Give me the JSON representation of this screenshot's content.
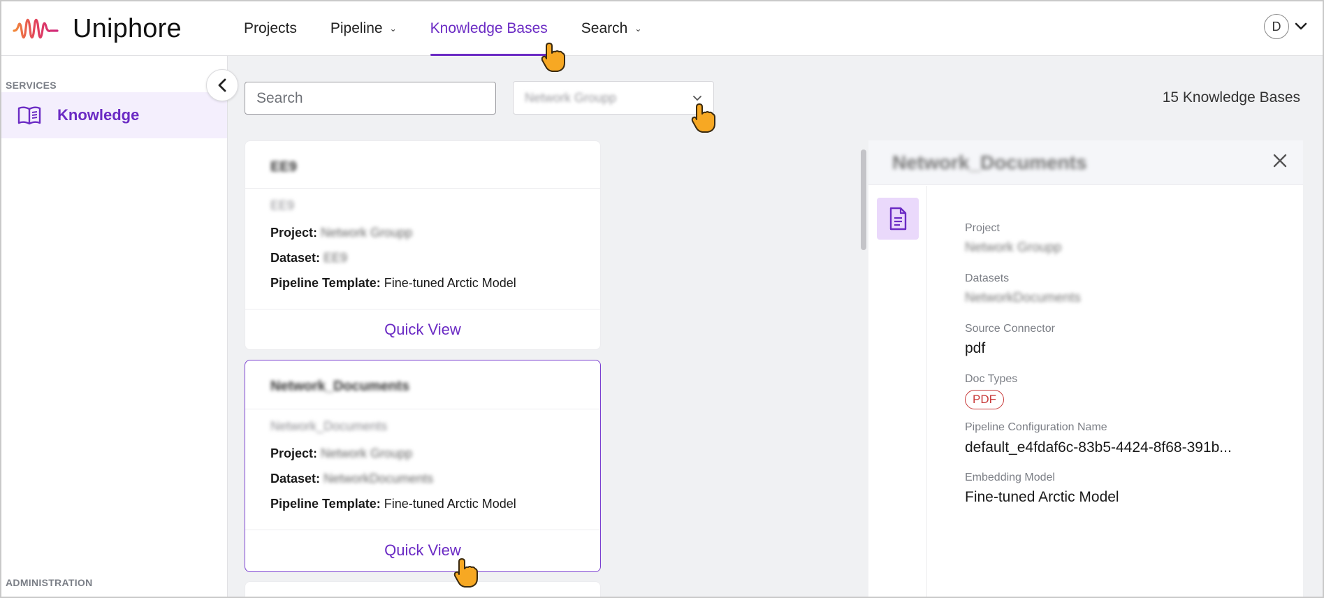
{
  "app": {
    "brand": "Uniphore",
    "accent": "#6b2bc4"
  },
  "nav": {
    "items": [
      {
        "label": "Projects",
        "has_menu": false
      },
      {
        "label": "Pipeline",
        "has_menu": true
      },
      {
        "label": "Knowledge Bases",
        "has_menu": false,
        "active": true
      },
      {
        "label": "Search",
        "has_menu": true
      }
    ],
    "user_initial": "D"
  },
  "sidebar": {
    "services_label": "SERVICES",
    "items": [
      {
        "label": "Knowledge",
        "icon": "book-icon",
        "active": true
      }
    ],
    "administration_label": "ADMINISTRATION"
  },
  "toolbar": {
    "search_placeholder": "Search",
    "project_filter_value": "Network Groupp",
    "count_text": "15 Knowledge Bases"
  },
  "cards": [
    {
      "title": "EE9",
      "subtitle": "EE9",
      "project_label": "Project:",
      "project_value": "Network Groupp",
      "dataset_label": "Dataset:",
      "dataset_value": "EE9",
      "template_label": "Pipeline Template:",
      "template_value": "Fine-tuned Arctic Model",
      "action": "Quick View"
    },
    {
      "title": "Network_Documents",
      "subtitle": "Network_Documents",
      "project_label": "Project:",
      "project_value": "Network Groupp",
      "dataset_label": "Dataset:",
      "dataset_value": "NetworkDocuments",
      "template_label": "Pipeline Template:",
      "template_value": "Fine-tuned Arctic Model",
      "action": "Quick View",
      "selected": true
    }
  ],
  "detail": {
    "title": "Network_Documents",
    "fields": {
      "project_label": "Project",
      "project_value": "Network Groupp",
      "datasets_label": "Datasets",
      "datasets_value": "NetworkDocuments",
      "source_label": "Source Connector",
      "source_value": "pdf",
      "doctypes_label": "Doc Types",
      "doctype_badge": "PDF",
      "pipeline_label": "Pipeline Configuration Name",
      "pipeline_value": "default_e4fdaf6c-83b5-4424-8f68-391b...",
      "embedding_label": "Embedding Model",
      "embedding_value": "Fine-tuned Arctic Model"
    }
  }
}
